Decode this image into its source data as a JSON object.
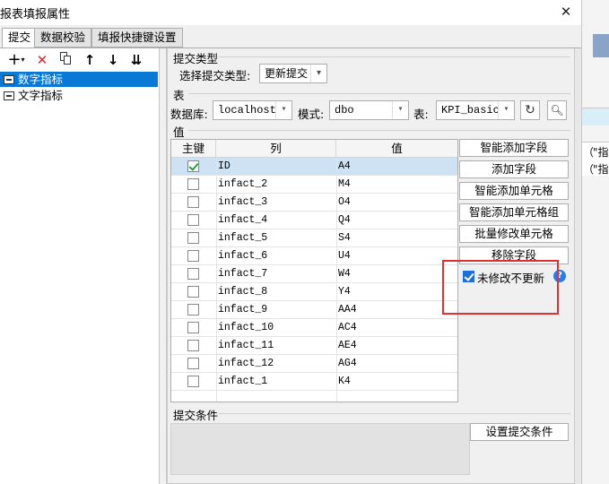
{
  "window": {
    "title": "报表填报属性"
  },
  "tabs": [
    {
      "label": "提交",
      "active": true
    },
    {
      "label": "数据校验",
      "active": false
    },
    {
      "label": "填报快捷键设置",
      "active": false
    }
  ],
  "toolbar": {
    "icons": [
      "add-icon",
      "delete-icon",
      "copy-icon",
      "move-up-icon",
      "move-down-icon",
      "move-bottom-icon"
    ]
  },
  "tree": {
    "items": [
      {
        "label": "数字指标",
        "selected": true
      },
      {
        "label": "文字指标",
        "selected": false
      }
    ]
  },
  "submit_type": {
    "section_label": "提交类型",
    "field_label": "选择提交类型:",
    "value": "更新提交"
  },
  "table_section": {
    "section_label": "表",
    "db_label": "数据库:",
    "db_value": "localhost",
    "schema_label": "模式:",
    "schema_value": "dbo",
    "table_label": "表:",
    "table_value": "KPI_basic"
  },
  "values_section": {
    "section_label": "值",
    "headers": [
      "主键",
      "列",
      "值"
    ],
    "rows": [
      {
        "key": true,
        "column": "ID",
        "value": "A4"
      },
      {
        "key": false,
        "column": "infact_2",
        "value": "M4"
      },
      {
        "key": false,
        "column": "infact_3",
        "value": "O4"
      },
      {
        "key": false,
        "column": "infact_4",
        "value": "Q4"
      },
      {
        "key": false,
        "column": "infact_5",
        "value": "S4"
      },
      {
        "key": false,
        "column": "infact_6",
        "value": "U4"
      },
      {
        "key": false,
        "column": "infact_7",
        "value": "W4"
      },
      {
        "key": false,
        "column": "infact_8",
        "value": "Y4"
      },
      {
        "key": false,
        "column": "infact_9",
        "value": "AA4"
      },
      {
        "key": false,
        "column": "infact_10",
        "value": "AC4"
      },
      {
        "key": false,
        "column": "infact_11",
        "value": "AE4"
      },
      {
        "key": false,
        "column": "infact_12",
        "value": "AG4"
      },
      {
        "key": false,
        "column": "infact_1",
        "value": "K4"
      }
    ]
  },
  "buttons": {
    "smart_add_field": "智能添加字段",
    "add_field": "添加字段",
    "smart_add_cell": "智能添加单元格",
    "smart_add_cell_group": "智能添加单元格组",
    "batch_modify_cell": "批量修改单元格",
    "remove_field": "移除字段",
    "unmodified_no_update": "未修改不更新",
    "unmodified_checked": true
  },
  "submit_condition": {
    "section_label": "提交条件",
    "button_label": "设置提交条件"
  },
  "background": {
    "cell_fragments": [
      "（",
      "\"指",
      "（",
      "\"指"
    ]
  },
  "colors": {
    "selection": "#0a79d6",
    "row_selection": "#cfe2f3",
    "highlight_box": "#e03030",
    "check_green": "#2c9d3a"
  }
}
